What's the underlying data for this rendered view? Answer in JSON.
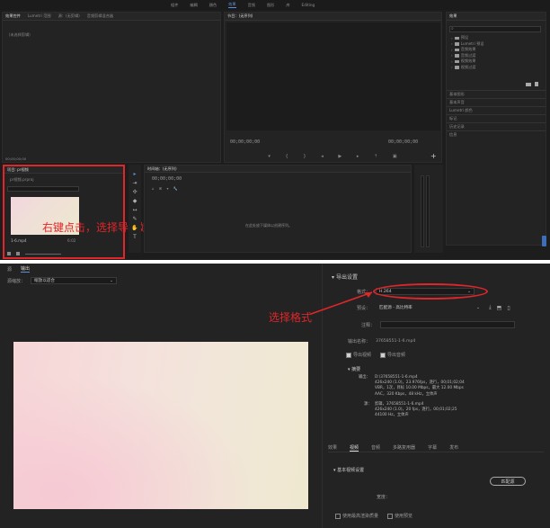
{
  "top": {
    "menu": [
      "組件",
      "編輯",
      "顏色",
      "效果",
      "音频",
      "图形",
      "库",
      "Editing"
    ],
    "active_menu_index": 3,
    "source_panel": {
      "tabs": [
        "效果控件",
        "Lumetri 范围",
        "源：(无剪辑)",
        "音频剪辑混合器"
      ],
      "no_clip": "（未选择剪辑）",
      "timecode": "00;00;00;00"
    },
    "program_monitor": {
      "title": "节目：(无序列)",
      "tc_left": "00;00;00;00",
      "tc_right": "00;00;00;00"
    },
    "effects_panel": {
      "title": "效果",
      "tree": [
        "预设",
        "Lumetri 预设",
        "音频效果",
        "音频过渡",
        "视频效果",
        "视频过渡"
      ],
      "sections": [
        "基本图形",
        "基本声音",
        "Lumetri 颜色",
        "标记",
        "历史记录",
        "信息"
      ]
    },
    "project_panel": {
      "title": "项目: pr视频",
      "file": "pr视频.prproj",
      "clip_name": "1-6.mp4",
      "clip_duration": "6:02",
      "search_placeholder": ""
    },
    "timeline": {
      "title": "时间轴：(无序列)",
      "timecode": "00;00;00;00",
      "drop_hint": "在此处放下媒体以创建序列。"
    },
    "annotation": "右键点击，选择导出媒体"
  },
  "bottom": {
    "tabs": [
      "源",
      "输出"
    ],
    "source_scaling_label": "源缩放：",
    "source_scaling_value": "缩放以适合",
    "export_settings": {
      "title": "导出设置",
      "format_label": "格式：",
      "format_value": "H.264",
      "preset_label": "预设：",
      "preset_value": "匹配源 - 高比特率",
      "comment_label": "注释：",
      "comment_value": "",
      "output_name_label": "输出名称：",
      "output_name_value": "37658551-1-6.mp4",
      "export_video": "导出视频",
      "export_audio": "导出音频",
      "summary_title": "摘要",
      "summary_output_label": "输出：",
      "summary_output_lines": [
        "D:\\37658551-1-6.mp4",
        "426x240 (1.0)，23.976fps，逐行，00;01;02;04",
        "VBR，1次，目标 10.00 Mbps，最大 12.00 Mbps",
        "AAC，320 Kbps，48 kHz，立体声"
      ],
      "summary_source_label": "源：",
      "summary_source_lines": [
        "剪辑，37658551-1-6.mp4",
        "426x240 (1.0)，20 fps，逐行，00;01;02;25",
        "44100 Hz，立体声"
      ]
    },
    "settings_tabs": [
      "效果",
      "视频",
      "音频",
      "多路复用器",
      "字幕",
      "发布"
    ],
    "active_settings_tab": 1,
    "basic_video": {
      "title": "基本视频设置",
      "match_source_button": "匹配源",
      "width_label": "宽度："
    },
    "footer": {
      "max_render_quality": "使用最高渲染质量",
      "use_previews": "使用预览"
    },
    "annotation": "选择格式"
  },
  "colors": {
    "accent_blue": "#5b8fd6",
    "annotation_red": "#e0262a",
    "panel_bg": "#232323"
  }
}
